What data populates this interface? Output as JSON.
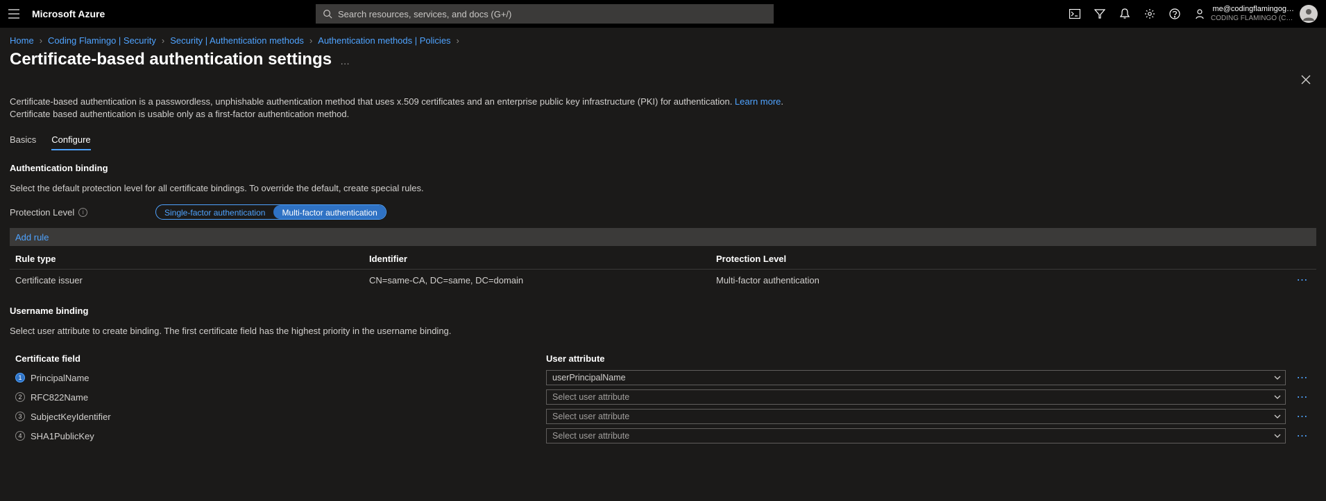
{
  "topbar": {
    "brand": "Microsoft Azure",
    "search_placeholder": "Search resources, services, and docs (G+/)",
    "account_email": "me@codingflamingog…",
    "account_directory": "CODING FLAMINGO (CODINGFL…"
  },
  "breadcrumb": [
    "Home",
    "Coding Flamingo | Security",
    "Security | Authentication methods",
    "Authentication methods | Policies"
  ],
  "page_title": "Certificate-based authentication settings",
  "intro_line1": "Certificate-based authentication is a passwordless, unphishable authentication method that uses x.509 certificates and an enterprise public key infrastructure (PKI) for authentication. ",
  "intro_link": "Learn more",
  "intro_period": ".",
  "intro_line2": "Certificate based authentication is usable only as a first-factor authentication method.",
  "tabs": {
    "basics": "Basics",
    "configure": "Configure"
  },
  "auth_binding": {
    "title": "Authentication binding",
    "desc": "Select the default protection level for all certificate bindings. To override the default, create special rules.",
    "protection_label": "Protection Level",
    "option_single": "Single-factor authentication",
    "option_multi": "Multi-factor authentication",
    "add_rule": "Add rule",
    "col_rule_type": "Rule type",
    "col_identifier": "Identifier",
    "col_protection": "Protection Level",
    "rows": [
      {
        "type": "Certificate issuer",
        "identifier": "CN=same-CA, DC=same, DC=domain",
        "protection": "Multi-factor authentication"
      }
    ]
  },
  "user_binding": {
    "title": "Username binding",
    "desc": "Select user attribute to create binding. The first certificate field has the highest priority in the username binding.",
    "col_certfield": "Certificate field",
    "col_userattr": "User attribute",
    "placeholder": "Select user attribute",
    "rows": [
      {
        "rank": "1",
        "field": "PrincipalName",
        "attr": "userPrincipalName",
        "first": true
      },
      {
        "rank": "2",
        "field": "RFC822Name",
        "attr": "",
        "first": false
      },
      {
        "rank": "3",
        "field": "SubjectKeyIdentifier",
        "attr": "",
        "first": false
      },
      {
        "rank": "4",
        "field": "SHA1PublicKey",
        "attr": "",
        "first": false
      }
    ]
  }
}
